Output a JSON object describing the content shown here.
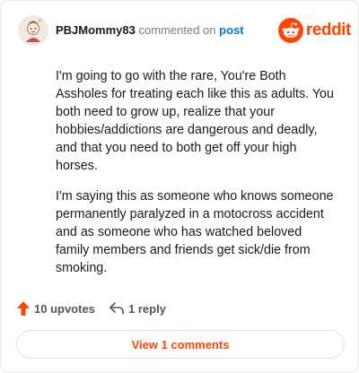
{
  "header": {
    "username": "PBJMommy83",
    "action_text": "commented on",
    "post_link": "post",
    "brand": "reddit"
  },
  "comment": {
    "paragraphs": [
      "I'm going to go with the rare, You're Both Assholes for treating each like this as adults. You both need to grow up, realize that your hobbies/addictions are dangerous and deadly, and that you need to both get off your high horses.",
      "I'm saying this as someone who knows someone permanently paralyzed in a motocross accident and as someone who has watched beloved family members and friends get sick/die from smoking."
    ]
  },
  "actions": {
    "upvotes_label": "10 upvotes",
    "reply_label": "1 reply"
  },
  "footer": {
    "view_comments_label": "View 1 comments"
  },
  "colors": {
    "brand": "#ff4500",
    "link": "#0079d3",
    "muted": "#7c7c7c",
    "text": "#1a1a1b"
  },
  "icons": {
    "avatar": "avatar-icon",
    "brand": "reddit-logo-icon",
    "upvote": "upvote-arrow-icon",
    "reply": "reply-arrow-icon"
  }
}
